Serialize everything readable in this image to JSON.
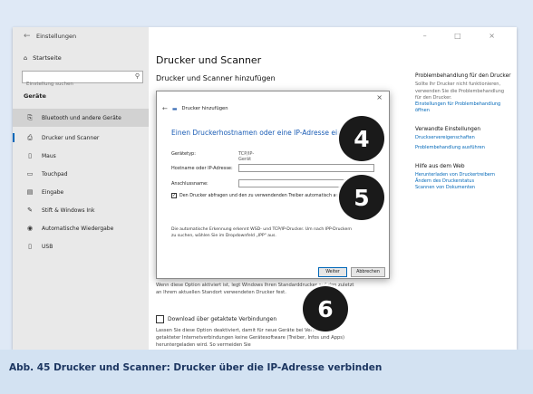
{
  "window": {
    "title": "Einstellungen",
    "back_icon": "←",
    "controls": "–  □  ×"
  },
  "sidebar": {
    "home": "Startseite",
    "search_placeholder": "Einstellung suchen",
    "group": "Geräte",
    "items": [
      {
        "label": "Bluetooth und andere Geräte",
        "icon": "bluetooth-icon"
      },
      {
        "label": "Drucker und Scanner",
        "icon": "printer-icon"
      },
      {
        "label": "Maus",
        "icon": "mouse-icon"
      },
      {
        "label": "Touchpad",
        "icon": "touchpad-icon"
      },
      {
        "label": "Eingabe",
        "icon": "keyboard-icon"
      },
      {
        "label": "Stift & Windows Ink",
        "icon": "pen-icon"
      },
      {
        "label": "Automatische Wiedergabe",
        "icon": "autoplay-icon"
      },
      {
        "label": "USB",
        "icon": "usb-icon"
      }
    ]
  },
  "main": {
    "title": "Drucker und Scanner",
    "subtitle": "Drucker und Scanner hinzufügen",
    "option_text": "Wenn diese Option aktiviert ist, legt Windows Ihren Standarddrucker auf den zuletzt an Ihrem aktuellen Standort verwendeten Drucker fest.",
    "download_label": "Download über getaktete Verbindungen",
    "download_text": "Lassen Sie diese Option deaktiviert, damit für neue Geräte bei Verwendung getakteter Internetverbindungen keine Gerätesoftware (Treiber, Infos und Apps) heruntergeladen wird. So vermeiden Sie"
  },
  "right": {
    "trouble_heading": "Problembehandlung für den Drucker",
    "trouble_text": "Sollte Ihr Drucker nicht funktionieren, verwenden Sie die Problembehandlung für den Drucker.",
    "trouble_link": "Einstellungen für Problembehandlung öffnen",
    "related_heading": "Verwandte Einstellungen",
    "related_link1": "Druckservereigenschaften",
    "related_link2": "Problembehandlung ausführen",
    "web_heading": "Hilfe aus dem Web",
    "web_link1": "Herunterladen von Druckertreibern",
    "web_link2": "Ändern des Druckerstatus",
    "web_link3": "Scannen von Dokumenten"
  },
  "dialog": {
    "header": "Drucker hinzufügen",
    "title": "Einen Druckerhostnamen oder eine IP-Adresse eingeben",
    "device_type_label": "Gerätetyp:",
    "device_type_value": "TCP/IP-Gerät",
    "host_label": "Hostname oder IP-Adresse:",
    "host_value": "",
    "port_label": "Anschlussname:",
    "port_value": "",
    "checkbox_label": "Den Drucker abfragen und den zu verwendenden Treiber automatisch auswählen",
    "info_text": "Die automatische Erkennung erkennt WSD- und TCP/IP-Drucker. Um nach IPP-Druckern zu suchen, wählen Sie im Dropdownfeld „IPP\" aus.",
    "next_label": "Weiter",
    "cancel_label": "Abbrechen"
  },
  "callouts": [
    "4",
    "5",
    "6"
  ],
  "caption": "Abb. 45  Drucker und Scanner: Drucker über die IP-Adresse verbinden"
}
